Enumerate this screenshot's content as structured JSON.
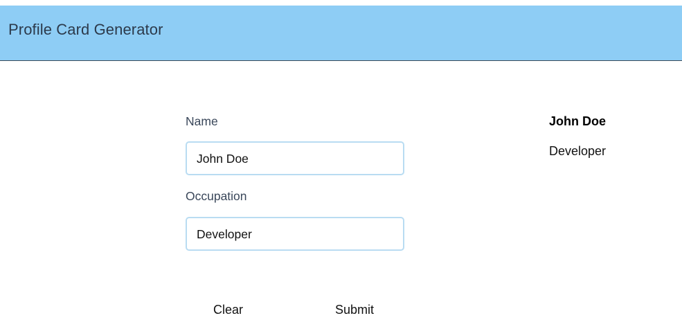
{
  "header": {
    "title": "Profile Card Generator",
    "background": "#8ecdf5"
  },
  "form": {
    "name_label": "Name",
    "name_value": "John Doe",
    "occupation_label": "Occupation",
    "occupation_value": "Developer"
  },
  "preview": {
    "name": "John Doe",
    "occupation": "Developer"
  },
  "actions": {
    "clear_label": "Clear",
    "submit_label": "Submit"
  },
  "colors": {
    "input_border": "#b9dcf2",
    "label_text": "#3a475a"
  }
}
